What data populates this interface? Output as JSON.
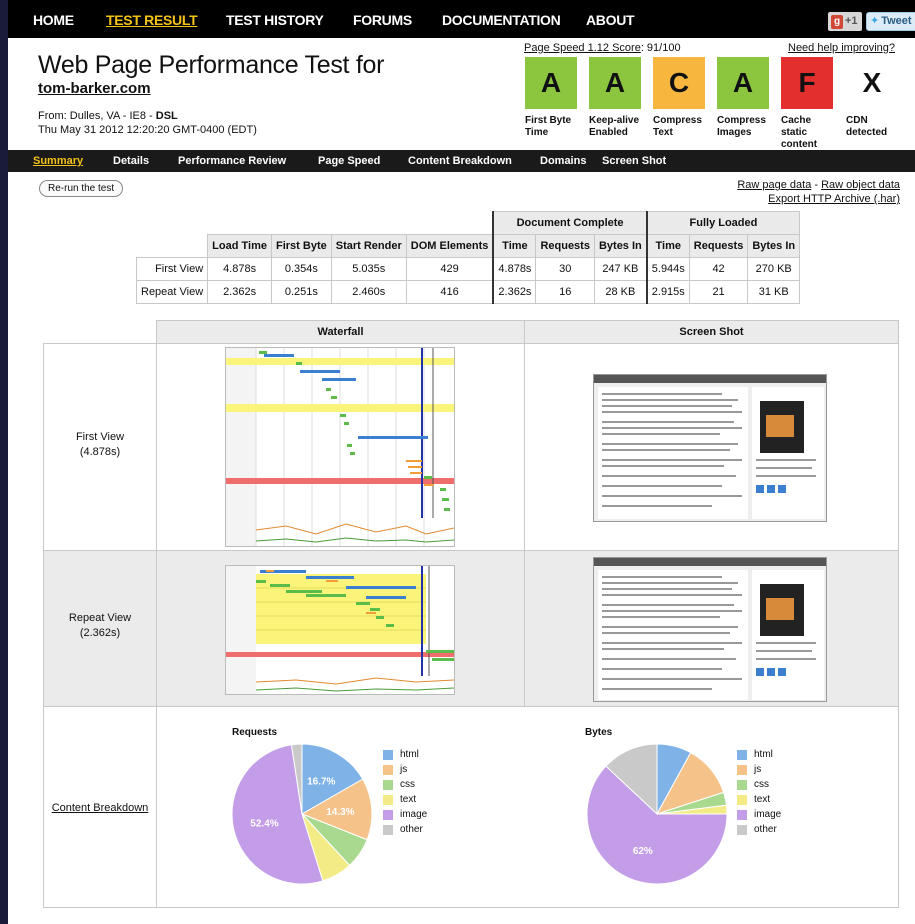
{
  "topnav": {
    "items": [
      "HOME",
      "TEST RESULT",
      "TEST HISTORY",
      "FORUMS",
      "DOCUMENTATION",
      "ABOUT"
    ],
    "gplus": "+1",
    "tweet": "Tweet"
  },
  "header": {
    "title": "Web Page Performance Test for",
    "site": "tom-barker.com",
    "from_prefix": "From: Dulles, VA - IE8 - ",
    "from_conn": "DSL",
    "date": "Thu May 31 2012 12:20:20 GMT-0400 (EDT)",
    "pagespeed_label": "Page Speed 1.12 Score",
    "pagespeed_value": ": 91/100",
    "help": "Need help improving?"
  },
  "grades": [
    {
      "letter": "A",
      "label": "First Byte Time",
      "color": "#8cc63f"
    },
    {
      "letter": "A",
      "label": "Keep-alive Enabled",
      "color": "#8cc63f"
    },
    {
      "letter": "C",
      "label": "Compress Text",
      "color": "#f7b73f"
    },
    {
      "letter": "A",
      "label": "Compress Images",
      "color": "#8cc63f"
    },
    {
      "letter": "F",
      "label": "Cache static content",
      "color": "#e3302f"
    },
    {
      "letter": "X",
      "label": "CDN detected",
      "color": "#ffffff"
    }
  ],
  "subnav": {
    "items": [
      "Summary",
      "Details",
      "Performance Review",
      "Page Speed",
      "Content Breakdown",
      "Domains",
      "Screen Shot"
    ]
  },
  "rerun": "Re-run the test",
  "links": {
    "raw_page": "Raw page data",
    "sep": " - ",
    "raw_object": "Raw object data",
    "export": "Export HTTP Archive (.har)"
  },
  "results": {
    "group_doc": "Document Complete",
    "group_full": "Fully Loaded",
    "columns": [
      "Load Time",
      "First Byte",
      "Start Render",
      "DOM Elements",
      "Time",
      "Requests",
      "Bytes In",
      "Time",
      "Requests",
      "Bytes In"
    ],
    "rows": [
      {
        "label": "First View",
        "cells": [
          "4.878s",
          "0.354s",
          "5.035s",
          "429",
          "4.878s",
          "30",
          "247 KB",
          "5.944s",
          "42",
          "270 KB"
        ]
      },
      {
        "label": "Repeat View",
        "cells": [
          "2.362s",
          "0.251s",
          "2.460s",
          "416",
          "2.362s",
          "16",
          "28 KB",
          "2.915s",
          "21",
          "31 KB"
        ]
      }
    ]
  },
  "grid": {
    "waterfall_header": "Waterfall",
    "screenshot_header": "Screen Shot",
    "first_view": "First View",
    "first_view_time": "(4.878s)",
    "repeat_view": "Repeat View",
    "repeat_view_time": "(2.362s)",
    "content_breakdown": "Content Breakdown"
  },
  "content_breakdown": {
    "requests_title": "Requests",
    "bytes_title": "Bytes",
    "legend": [
      {
        "label": "html",
        "color": "#7fb3e8"
      },
      {
        "label": "js",
        "color": "#f5c38a"
      },
      {
        "label": "css",
        "color": "#a9d98f"
      },
      {
        "label": "text",
        "color": "#f3ec86"
      },
      {
        "label": "image",
        "color": "#c39de8"
      },
      {
        "label": "other",
        "color": "#c9c9c9"
      }
    ],
    "requests_pct_labels": {
      "html": "16.7%",
      "js": "14.3%",
      "image": "52.4%"
    },
    "bytes_pct_labels": {
      "image": "62%"
    }
  },
  "chart_data": [
    {
      "type": "pie",
      "title": "Requests",
      "categories": [
        "html",
        "js",
        "css",
        "text",
        "image",
        "other"
      ],
      "values": [
        16.7,
        14.3,
        7.1,
        7.1,
        52.4,
        2.4
      ]
    },
    {
      "type": "pie",
      "title": "Bytes",
      "categories": [
        "html",
        "js",
        "css",
        "text",
        "image",
        "other"
      ],
      "values": [
        8,
        12,
        3,
        2,
        62,
        13
      ]
    }
  ]
}
